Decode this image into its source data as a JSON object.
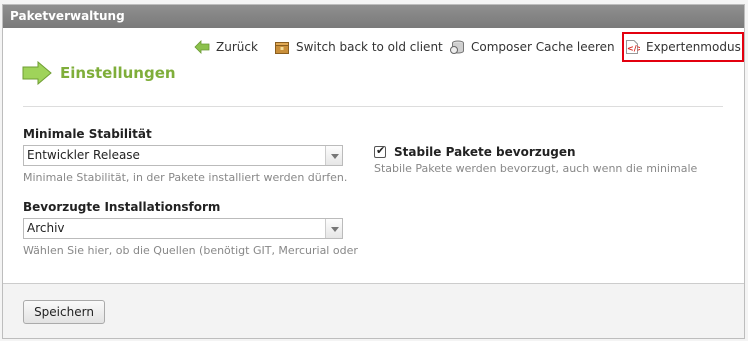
{
  "panel": {
    "title": "Paketverwaltung"
  },
  "toolbar": {
    "back_label": "Zurück",
    "switch_label": "Switch back to old client",
    "cache_label": "Composer Cache leeren",
    "expert_label": "Expertenmodus"
  },
  "headline": {
    "title": "Einstellungen"
  },
  "stability": {
    "label": "Minimale Stabilität",
    "value": "Entwickler Release",
    "help": "Minimale Stabilität, in der Pakete installiert werden dürfen."
  },
  "install_form": {
    "label": "Bevorzugte Installationsform",
    "value": "Archiv",
    "help": "Wählen Sie hier, ob die Quellen (benötigt GIT, Mercurial oder"
  },
  "prefer_stable": {
    "label": "Stabile Pakete bevorzugen",
    "checked": true,
    "help": "Stabile Pakete werden bevorzugt, auch wenn die minimale"
  },
  "footer": {
    "save_label": "Speichern"
  },
  "colors": {
    "accent_green": "#7fae3a",
    "highlight_red": "#e3000f",
    "titlebar": "#868686"
  }
}
